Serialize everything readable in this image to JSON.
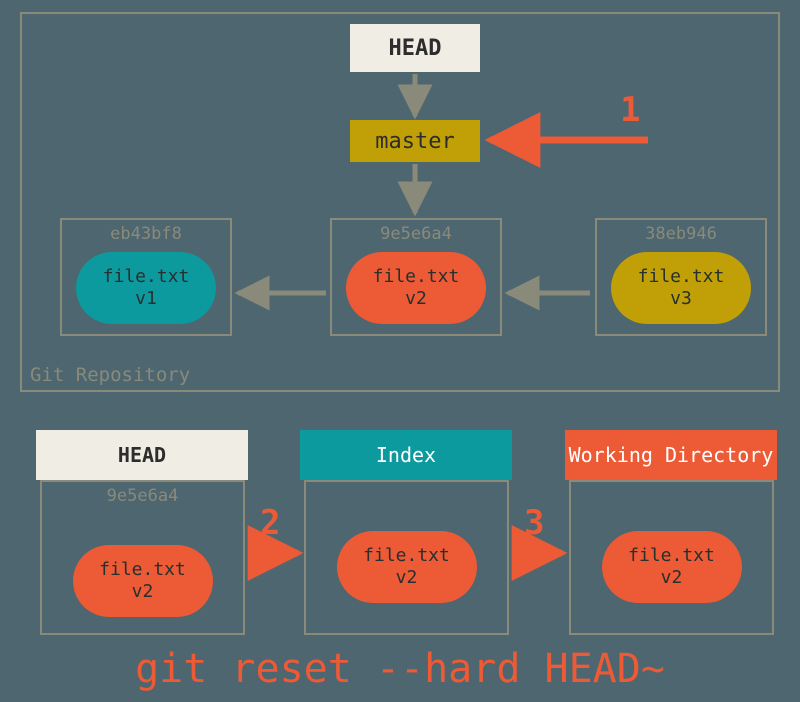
{
  "repo": {
    "label": "Git Repository",
    "head": "HEAD",
    "branch": "master",
    "commits": [
      {
        "hash": "eb43bf8",
        "file": "file.txt",
        "version": "v1",
        "color": "teal"
      },
      {
        "hash": "9e5e6a4",
        "file": "file.txt",
        "version": "v2",
        "color": "orange"
      },
      {
        "hash": "38eb946",
        "file": "file.txt",
        "version": "v3",
        "color": "olive"
      }
    ]
  },
  "steps": {
    "one": "1",
    "two": "2",
    "three": "3"
  },
  "bottom": {
    "head": {
      "title": "HEAD",
      "hash": "9e5e6a4",
      "file": "file.txt",
      "version": "v2"
    },
    "index": {
      "title": "Index",
      "file": "file.txt",
      "version": "v2"
    },
    "wd": {
      "title": "Working Directory",
      "file": "file.txt",
      "version": "v2"
    }
  },
  "command": "git reset --hard HEAD~"
}
